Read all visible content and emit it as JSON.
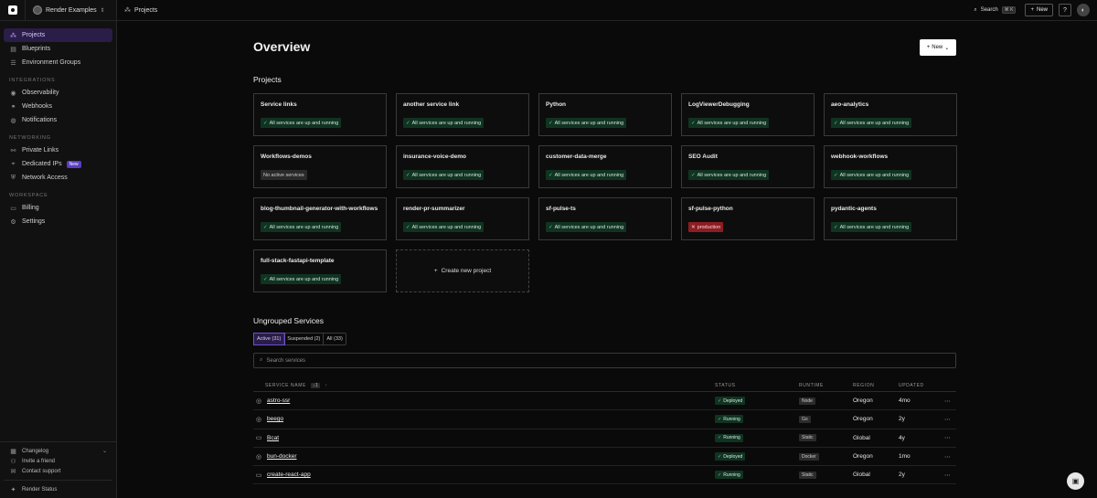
{
  "workspace": {
    "name": "Render Examples"
  },
  "sidebar": {
    "items": [
      {
        "label": "Projects",
        "icon": "projects-icon"
      },
      {
        "label": "Blueprints",
        "icon": "blueprints-icon"
      },
      {
        "label": "Environment Groups",
        "icon": "env-groups-icon"
      }
    ],
    "integrations_title": "INTEGRATIONS",
    "integrations": [
      {
        "label": "Observability",
        "icon": "observability-icon"
      },
      {
        "label": "Webhooks",
        "icon": "webhooks-icon"
      },
      {
        "label": "Notifications",
        "icon": "notifications-icon"
      }
    ],
    "networking_title": "NETWORKING",
    "networking": [
      {
        "label": "Private Links",
        "icon": "link-icon"
      },
      {
        "label": "Dedicated IPs",
        "icon": "ip-icon",
        "badge": "New"
      },
      {
        "label": "Network Access",
        "icon": "network-icon"
      }
    ],
    "workspace_title": "WORKSPACE",
    "workspace": [
      {
        "label": "Billing",
        "icon": "billing-icon"
      },
      {
        "label": "Settings",
        "icon": "settings-icon"
      }
    ],
    "footer": {
      "changelog": "Changelog",
      "invite": "Invite a friend",
      "contact": "Contact support",
      "status": "Render Status"
    }
  },
  "topbar": {
    "breadcrumb": "Projects",
    "search_label": "Search",
    "search_kbd": "⌘ K",
    "new_label": "New"
  },
  "main": {
    "title": "Overview",
    "new_button": "New",
    "projects_title": "Projects",
    "projects": [
      {
        "name": "Service links",
        "status": "All services are up and running",
        "kind": "ok"
      },
      {
        "name": "another service link",
        "status": "All services are up and running",
        "kind": "ok"
      },
      {
        "name": "Python",
        "status": "All services are up and running",
        "kind": "ok"
      },
      {
        "name": "LogViewerDebugging",
        "status": "All services are up and running",
        "kind": "ok"
      },
      {
        "name": "aeo-analytics",
        "status": "All services are up and running",
        "kind": "ok"
      },
      {
        "name": "Workflows-demos",
        "status": "No active services",
        "kind": "none"
      },
      {
        "name": "insurance-voice-demo",
        "status": "All services are up and running",
        "kind": "ok"
      },
      {
        "name": "customer-data-merge",
        "status": "All services are up and running",
        "kind": "ok"
      },
      {
        "name": "SEO Audit",
        "status": "All services are up and running",
        "kind": "ok"
      },
      {
        "name": "webhook-workflows",
        "status": "All services are up and running",
        "kind": "ok"
      },
      {
        "name": "blog-thumbnail-generator-with-workflows",
        "status": "All services are up and running",
        "kind": "ok"
      },
      {
        "name": "render-pr-summarizer",
        "status": "All services are up and running",
        "kind": "ok"
      },
      {
        "name": "sf-pulse-ts",
        "status": "All services are up and running",
        "kind": "ok"
      },
      {
        "name": "sf-pulse-python",
        "status": "production",
        "kind": "err"
      },
      {
        "name": "pydantic-agents",
        "status": "All services are up and running",
        "kind": "ok"
      },
      {
        "name": "full-stack-fastapi-template",
        "status": "All services are up and running",
        "kind": "ok"
      }
    ],
    "create_project": "Create new project",
    "ungrouped_title": "Ungrouped Services",
    "tabs": [
      "Active (31)",
      "Suspended (2)",
      "All (33)"
    ],
    "search_placeholder": "Search services",
    "table": {
      "headers": {
        "name": "SERVICE NAME",
        "sort": "↓1",
        "status": "STATUS",
        "runtime": "RUNTIME",
        "region": "REGION",
        "updated": "UPDATED"
      },
      "rows": [
        {
          "name": "astro-ssr",
          "icon": "globe-icon",
          "status": "Deployed",
          "runtime": "Node",
          "region": "Oregon",
          "updated": "4mo"
        },
        {
          "name": "beego",
          "icon": "globe-icon",
          "status": "Running",
          "runtime": "Go",
          "region": "Oregon",
          "updated": "2y"
        },
        {
          "name": "Bcat",
          "icon": "static-site-icon",
          "status": "Running",
          "runtime": "Static",
          "region": "Global",
          "updated": "4y"
        },
        {
          "name": "bun-docker",
          "icon": "globe-icon",
          "status": "Deployed",
          "runtime": "Docker",
          "region": "Oregon",
          "updated": "1mo"
        },
        {
          "name": "create-react-app",
          "icon": "static-site-icon",
          "status": "Running",
          "runtime": "Static",
          "region": "Global",
          "updated": "2y"
        }
      ]
    }
  },
  "colors": {
    "accent": "#6b4fd8",
    "ok_bg": "#113322",
    "err_bg": "#8c1d22",
    "bg": "#0a0a0a"
  }
}
